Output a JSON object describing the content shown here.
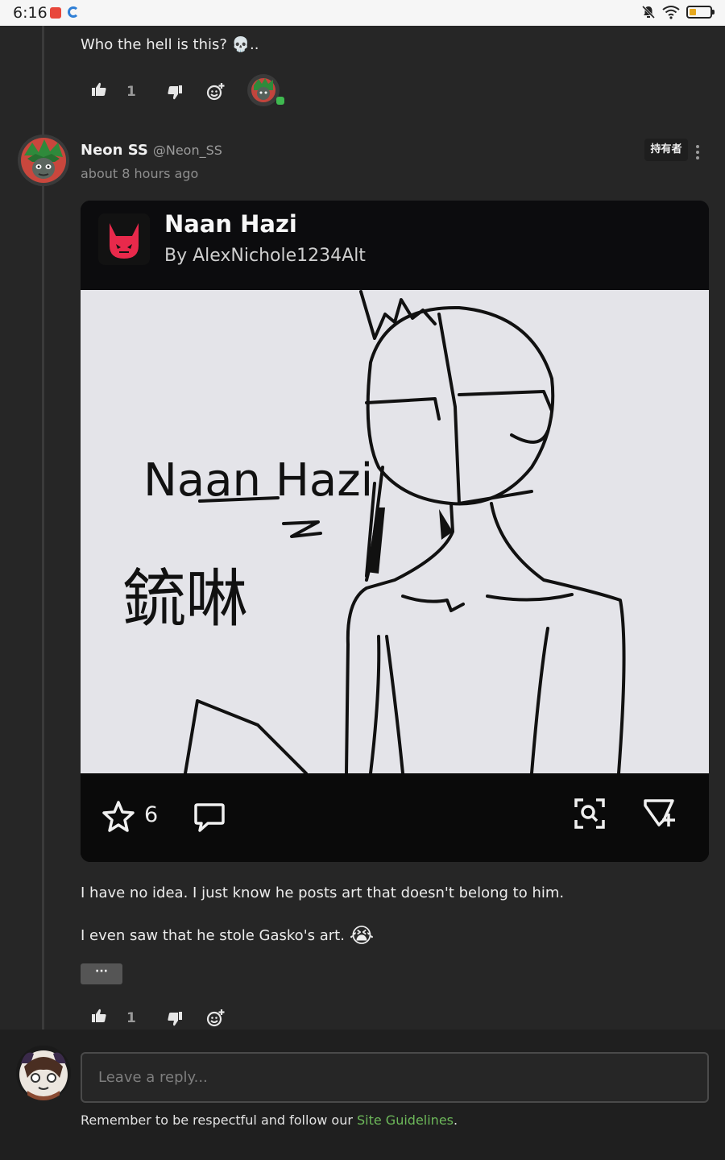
{
  "status_bar": {
    "time": "6:16"
  },
  "prev_comment": {
    "text": "Who the hell is this? 💀..",
    "likes": "1"
  },
  "comment": {
    "username": "Neon SS",
    "handle": "@Neon_SS",
    "timestamp": "about 8 hours ago",
    "badge": "持有者",
    "embed": {
      "title": "Naan Hazi",
      "author": "By AlexNichole1234Alt",
      "image_caption": "Naan Hazi",
      "image_caption_cjk": "鋶啉",
      "favorites": "6"
    },
    "paragraph_1": "I have no idea. I just know he posts art that doesn't belong to him.",
    "paragraph_2": "I even saw that he stole Gasko's art.",
    "paragraph_2_emoji": "😭",
    "more_label": "···",
    "likes": "1"
  },
  "reply": {
    "placeholder": "Leave a reply...",
    "notice_prefix": "Remember to be respectful and follow our ",
    "notice_link": "Site Guidelines",
    "notice_suffix": "."
  },
  "colors": {
    "background": "#262626",
    "link": "#6db85a",
    "online_dot": "#3fb950"
  }
}
